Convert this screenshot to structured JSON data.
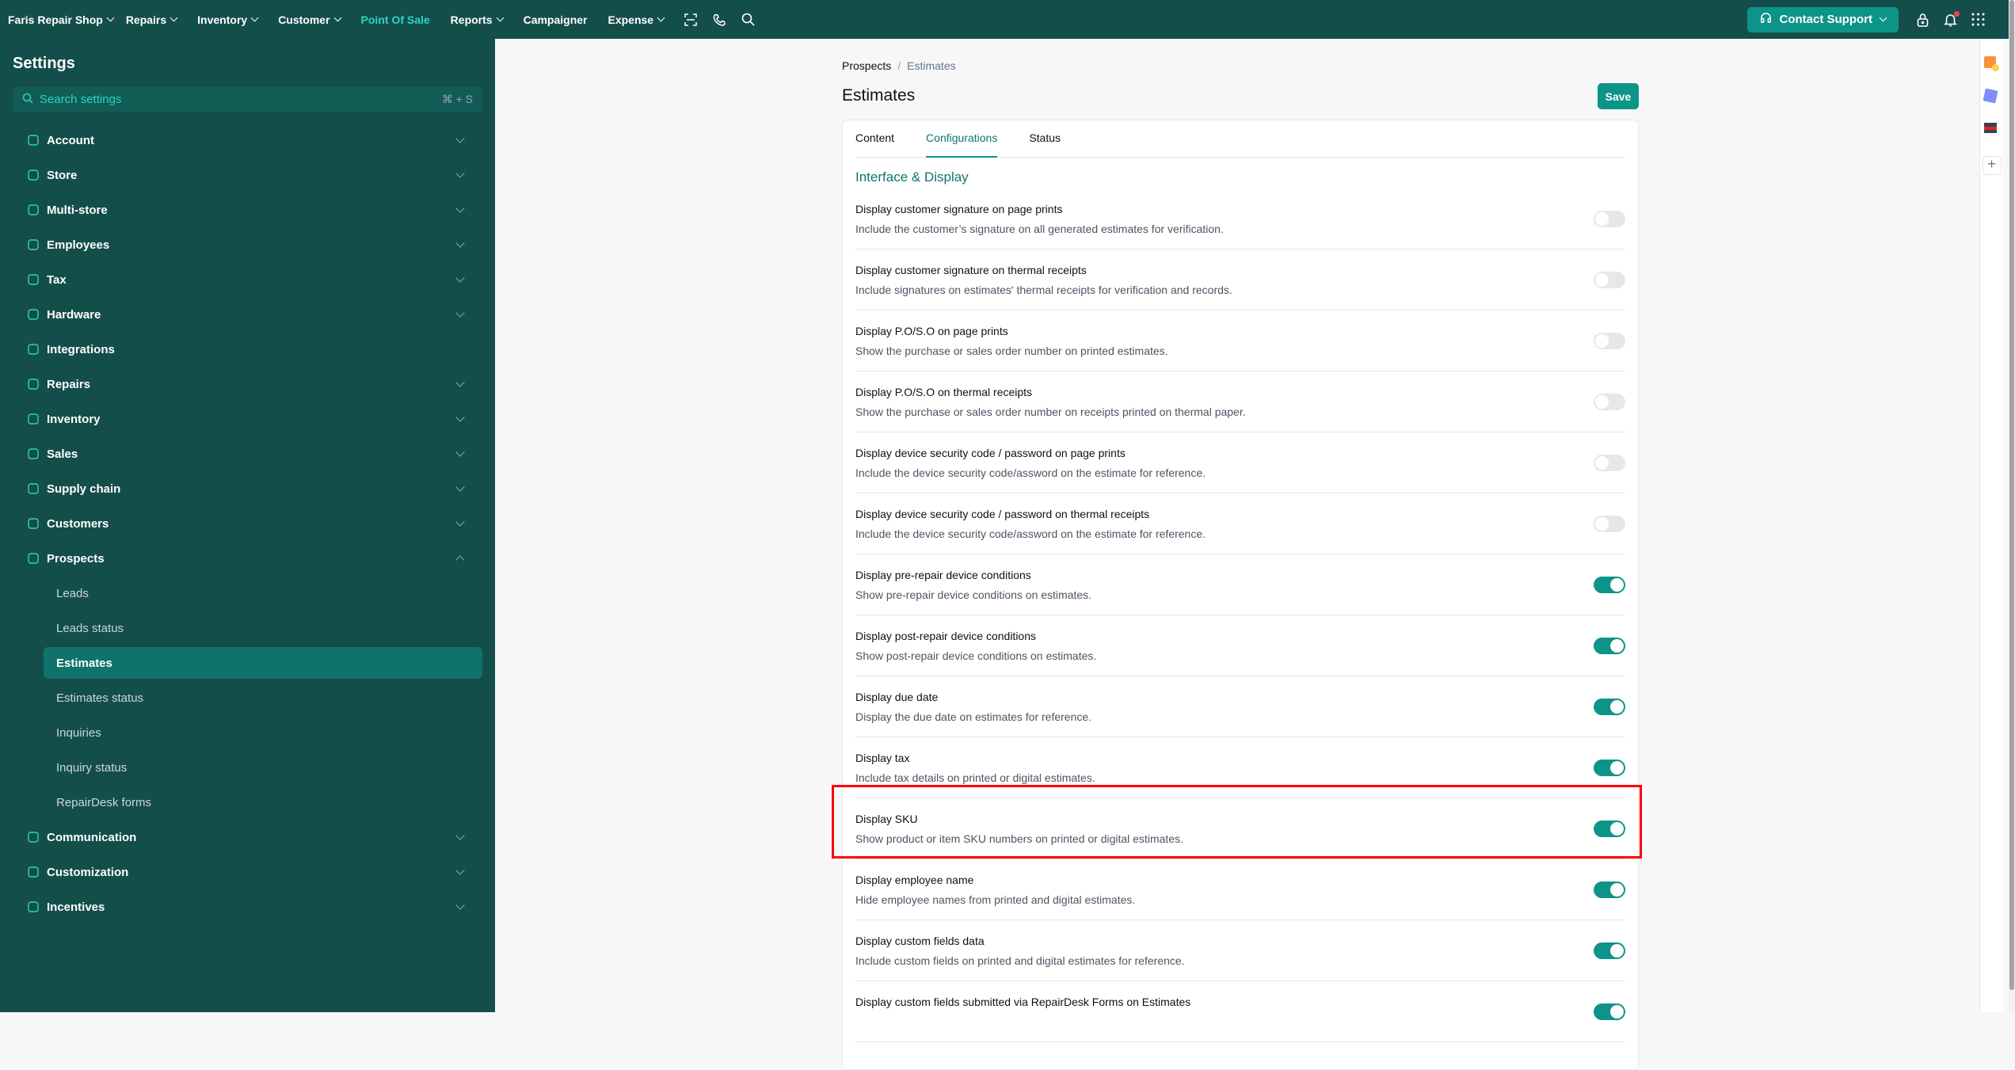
{
  "topbar": {
    "nav": [
      {
        "label": "Faris Repair Shop",
        "chevron": true
      },
      {
        "label": "Repairs",
        "chevron": true
      },
      {
        "label": "Inventory",
        "chevron": true
      },
      {
        "label": "Customer",
        "chevron": true
      },
      {
        "label": "Point Of Sale",
        "chevron": false,
        "active": true
      },
      {
        "label": "Reports",
        "chevron": true
      },
      {
        "label": "Campaigner",
        "chevron": false
      },
      {
        "label": "Expense",
        "chevron": true
      }
    ],
    "contact_support": "Contact Support"
  },
  "sidebar": {
    "title": "Settings",
    "search_placeholder": "Search settings",
    "search_shortcut": "⌘ + S",
    "items": [
      {
        "label": "Account",
        "icon": "user-circle-icon"
      },
      {
        "label": "Store",
        "icon": "store-icon"
      },
      {
        "label": "Multi-store",
        "icon": "building-icon"
      },
      {
        "label": "Employees",
        "icon": "users-icon"
      },
      {
        "label": "Tax",
        "icon": "money-bag-icon"
      },
      {
        "label": "Hardware",
        "icon": "printer-icon"
      },
      {
        "label": "Integrations",
        "icon": "plug-icon"
      },
      {
        "label": "Repairs",
        "icon": "wrench-icon"
      },
      {
        "label": "Inventory",
        "icon": "warehouse-icon"
      },
      {
        "label": "Sales",
        "icon": "shopping-bag-icon"
      },
      {
        "label": "Supply chain",
        "icon": "truck-icon"
      },
      {
        "label": "Customers",
        "icon": "users-icon"
      },
      {
        "label": "Prospects",
        "icon": "target-icon"
      }
    ],
    "prospects_sub": [
      "Leads",
      "Leads status",
      "Estimates",
      "Estimates status",
      "Inquiries",
      "Inquiry status",
      "RepairDesk forms"
    ],
    "items_after": [
      {
        "label": "Communication",
        "icon": "message-icon"
      },
      {
        "label": "Customization",
        "icon": "sliders-icon"
      },
      {
        "label": "Incentives",
        "icon": "gift-icon"
      }
    ]
  },
  "main": {
    "breadcrumb": [
      "Prospects",
      "Estimates"
    ],
    "title": "Estimates",
    "save_label": "Save",
    "tabs": [
      "Content",
      "Configurations",
      "Status"
    ],
    "active_tab": "Configurations",
    "section": "Interface & Display",
    "rows": [
      {
        "title": "Display customer signature on page prints",
        "desc": "Include the customer’s signature on all generated estimates for verification.",
        "on": false
      },
      {
        "title": "Display customer signature on thermal receipts",
        "desc": "Include signatures on estimates' thermal receipts for verification and records.",
        "on": false
      },
      {
        "title": "Display P.O/S.O on page prints",
        "desc": "Show the purchase or sales order number on printed estimates.",
        "on": false
      },
      {
        "title": "Display P.O/S.O on thermal receipts",
        "desc": "Show the purchase or sales order number on receipts printed on thermal paper.",
        "on": false
      },
      {
        "title": "Display device security code / password on page prints",
        "desc": "Include the device security code/assword on the estimate for reference.",
        "on": false
      },
      {
        "title": "Display device security code / password on thermal receipts",
        "desc": "Include the device security code/assword on the estimate for reference.",
        "on": false
      },
      {
        "title": "Display pre-repair device conditions",
        "desc": "Show pre-repair device conditions on estimates.",
        "on": true
      },
      {
        "title": "Display post-repair device conditions",
        "desc": "Show post-repair device conditions on estimates.",
        "on": true
      },
      {
        "title": "Display due date",
        "desc": "Display the due date on estimates for reference.",
        "on": true
      },
      {
        "title": "Display tax",
        "desc": "Include tax details on printed or digital estimates.",
        "on": true
      },
      {
        "title": "Display SKU",
        "desc": "Show product or item SKU numbers on printed or digital estimates.",
        "on": true
      },
      {
        "title": "Display employee name",
        "desc": "Hide employee names from printed and digital estimates.",
        "on": true
      },
      {
        "title": "Display custom fields data",
        "desc": "Include custom fields on printed and digital estimates for reference.",
        "on": true
      },
      {
        "title": "Display custom fields submitted via RepairDesk Forms on Estimates",
        "desc": "",
        "on": true
      }
    ]
  },
  "colors": {
    "brand_dark": "#144e4b",
    "accent": "#0d9488",
    "highlight": "#ff0000"
  }
}
